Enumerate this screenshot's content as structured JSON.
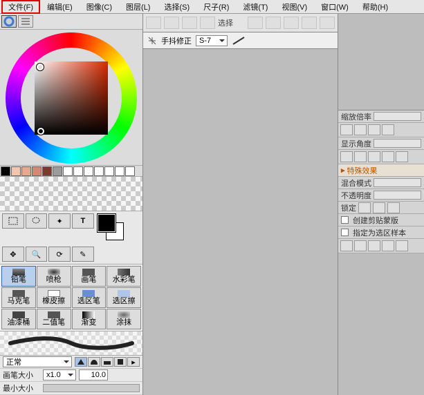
{
  "menu": {
    "items": [
      {
        "label": "文件(F)",
        "selected": true
      },
      {
        "label": "编辑(E)"
      },
      {
        "label": "图像(C)"
      },
      {
        "label": "图层(L)"
      },
      {
        "label": "选择(S)"
      },
      {
        "label": "尺子(R)"
      },
      {
        "label": "滤镜(T)"
      },
      {
        "label": "视图(V)"
      },
      {
        "label": "窗口(W)"
      },
      {
        "label": "帮助(H)"
      }
    ]
  },
  "swatches": [
    "#000000",
    "#f2c6b0",
    "#e8a98f",
    "#d28a74",
    "#7a3b2c",
    "#9c9c9c",
    "#ffffff",
    "#ffffff",
    "#ffffff",
    "#ffffff",
    "#ffffff",
    "#ffffff",
    "#ffffff"
  ],
  "brushes": [
    {
      "label": "铅笔",
      "sel": true
    },
    {
      "label": "喷枪"
    },
    {
      "label": "画笔"
    },
    {
      "label": "水彩笔"
    },
    {
      "label": "马克笔"
    },
    {
      "label": "橡皮擦"
    },
    {
      "label": "选区笔"
    },
    {
      "label": "选区擦"
    },
    {
      "label": "油漆桶"
    },
    {
      "label": "二值笔"
    },
    {
      "label": "渐变"
    },
    {
      "label": "涂抹"
    }
  ],
  "strip": {
    "sel_label": "选择"
  },
  "sub": {
    "stabilizer": "手抖修正",
    "value": "S-7"
  },
  "blend": {
    "label": "正常"
  },
  "size": {
    "label": "画笔大小",
    "mult": "x1.0",
    "val": "10.0"
  },
  "minsize": {
    "label": "最小大小"
  },
  "right": {
    "zoom": "缩放倍率",
    "angle": "显示角度",
    "fx": "特殊效果",
    "blend": "混合模式",
    "opacity": "不透明度",
    "lock": "锁定",
    "clip": "创建剪贴蒙版",
    "selmask": "指定为选区样本"
  }
}
